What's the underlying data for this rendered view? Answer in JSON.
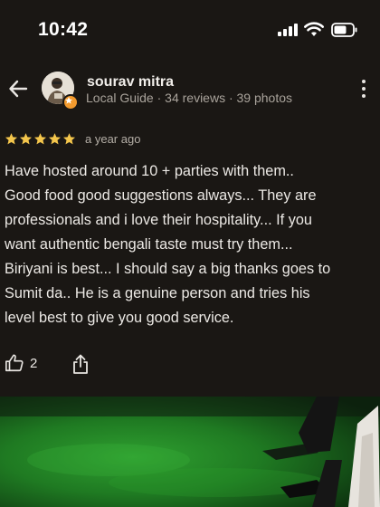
{
  "status_bar": {
    "time": "10:42"
  },
  "reviewer": {
    "name": "sourav mitra",
    "meta": "Local Guide · 34 reviews · 39 photos"
  },
  "rating": {
    "stars": 5,
    "max": 5,
    "date": "a year ago"
  },
  "review": {
    "lines": [
      "Have hosted around 10 + parties with them..",
      "Good food good suggestions always... They are",
      "professionals and i love their hospitality... If you",
      "want authentic bengali taste must try them...",
      "Biriyani is best... I should say a big thanks goes to",
      "Sumit da.. He is a genuine person and tries his",
      "level best to give you good service."
    ]
  },
  "actions": {
    "like_count": "2"
  },
  "icons": {
    "back": "arrow-left-icon",
    "more": "more-vert-icon",
    "like": "thumb-up-icon",
    "share": "share-icon",
    "badge": "local-guide-badge-icon"
  },
  "colors": {
    "background": "#1a1714",
    "star": "#f4c64c",
    "badge": "#f29a2e",
    "photo_green": "#1f7a22"
  }
}
